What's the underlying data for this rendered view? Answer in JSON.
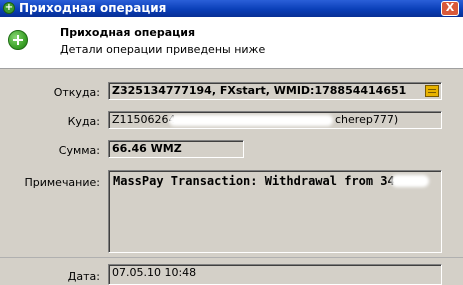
{
  "window": {
    "title": "Приходная операция",
    "close_label": "X"
  },
  "header": {
    "title": "Приходная операция",
    "subtitle": "Детали операции приведены ниже"
  },
  "fields": {
    "from": {
      "label": "Откуда:",
      "value": "Z325134777194, FXstart, WMID:178854414651"
    },
    "to": {
      "label": "Куда:",
      "value_start": "Z11506264",
      "value_end": "cherep777)"
    },
    "amount": {
      "label": "Сумма:",
      "value": "66.46 WMZ"
    },
    "note": {
      "label": "Примечание:",
      "value": "MassPay Transaction: Withdrawal from 34"
    },
    "date": {
      "label": "Дата:",
      "value": "07.05.10 10:48"
    }
  }
}
